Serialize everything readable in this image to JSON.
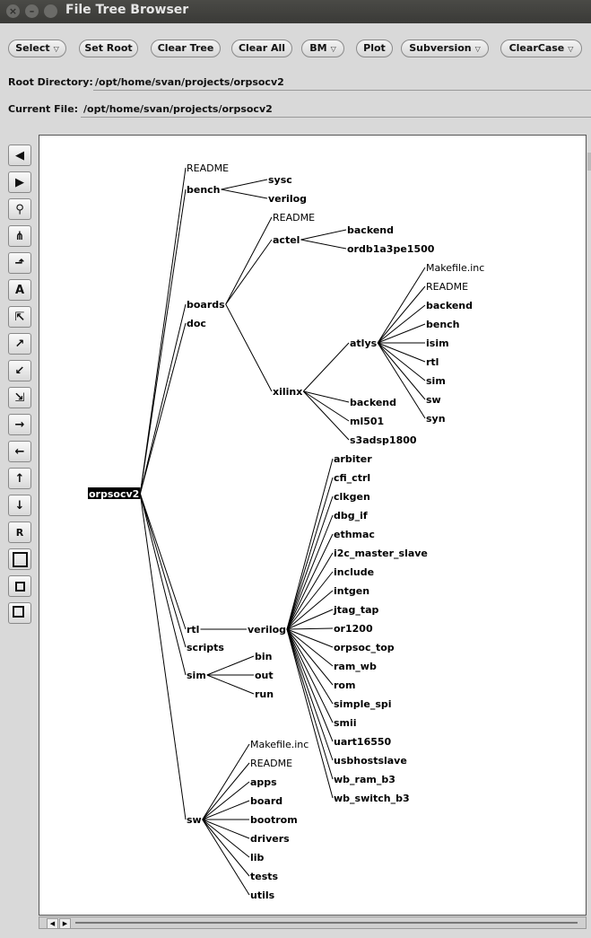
{
  "window": {
    "title": "File Tree Browser"
  },
  "toolbar": {
    "select": "Select",
    "set_root": "Set Root",
    "clear_tree": "Clear Tree",
    "clear_all": "Clear All",
    "bm": "BM",
    "plot": "Plot",
    "subversion": "Subversion",
    "clearcase": "ClearCase"
  },
  "paths": {
    "root_label": "Root Directory:",
    "root_value": "/opt/home/svan/projects/orpsocv2",
    "current_label": "Current File:",
    "current_value": "/opt/home/svan/projects/orpsocv2"
  },
  "sidebar": {
    "text_tool": "A",
    "refresh": "R"
  },
  "tree": {
    "root": "orpsocv2",
    "nodes": [
      {
        "id": "readme1",
        "label": "README",
        "parent": "root",
        "bold": false
      },
      {
        "id": "bench",
        "label": "bench",
        "parent": "root",
        "bold": true
      },
      {
        "id": "sysc",
        "label": "sysc",
        "parent": "bench",
        "bold": true
      },
      {
        "id": "verilog1",
        "label": "verilog",
        "parent": "bench",
        "bold": true
      },
      {
        "id": "boards",
        "label": "boards",
        "parent": "root",
        "bold": true
      },
      {
        "id": "readme2",
        "label": "README",
        "parent": "boards",
        "bold": false
      },
      {
        "id": "actel",
        "label": "actel",
        "parent": "boards",
        "bold": true
      },
      {
        "id": "backend1",
        "label": "backend",
        "parent": "actel",
        "bold": true
      },
      {
        "id": "ordb",
        "label": "ordb1a3pe1500",
        "parent": "actel",
        "bold": true
      },
      {
        "id": "xilinx",
        "label": "xilinx",
        "parent": "boards",
        "bold": true
      },
      {
        "id": "atlys",
        "label": "atlys",
        "parent": "xilinx",
        "bold": true
      },
      {
        "id": "mkinc1",
        "label": "Makefile.inc",
        "parent": "atlys",
        "bold": false
      },
      {
        "id": "readme3",
        "label": "README",
        "parent": "atlys",
        "bold": false
      },
      {
        "id": "backend2",
        "label": "backend",
        "parent": "atlys",
        "bold": true
      },
      {
        "id": "bench2",
        "label": "bench",
        "parent": "atlys",
        "bold": true
      },
      {
        "id": "isim",
        "label": "isim",
        "parent": "atlys",
        "bold": true
      },
      {
        "id": "rtl2",
        "label": "rtl",
        "parent": "atlys",
        "bold": true
      },
      {
        "id": "sim2",
        "label": "sim",
        "parent": "atlys",
        "bold": true
      },
      {
        "id": "sw2",
        "label": "sw",
        "parent": "atlys",
        "bold": true
      },
      {
        "id": "syn",
        "label": "syn",
        "parent": "atlys",
        "bold": true
      },
      {
        "id": "backend3",
        "label": "backend",
        "parent": "xilinx",
        "bold": true
      },
      {
        "id": "ml501",
        "label": "ml501",
        "parent": "xilinx",
        "bold": true
      },
      {
        "id": "s3adsp",
        "label": "s3adsp1800",
        "parent": "xilinx",
        "bold": true
      },
      {
        "id": "doc",
        "label": "doc",
        "parent": "root",
        "bold": true
      },
      {
        "id": "rtl",
        "label": "rtl",
        "parent": "root",
        "bold": true
      },
      {
        "id": "verilog2",
        "label": "verilog",
        "parent": "rtl",
        "bold": true
      },
      {
        "id": "arbiter",
        "label": "arbiter",
        "parent": "verilog2",
        "bold": true
      },
      {
        "id": "cfi",
        "label": "cfi_ctrl",
        "parent": "verilog2",
        "bold": true
      },
      {
        "id": "clkgen",
        "label": "clkgen",
        "parent": "verilog2",
        "bold": true
      },
      {
        "id": "dbg",
        "label": "dbg_if",
        "parent": "verilog2",
        "bold": true
      },
      {
        "id": "ethmac",
        "label": "ethmac",
        "parent": "verilog2",
        "bold": true
      },
      {
        "id": "i2c",
        "label": "i2c_master_slave",
        "parent": "verilog2",
        "bold": true
      },
      {
        "id": "include",
        "label": "include",
        "parent": "verilog2",
        "bold": true
      },
      {
        "id": "intgen",
        "label": "intgen",
        "parent": "verilog2",
        "bold": true
      },
      {
        "id": "jtag",
        "label": "jtag_tap",
        "parent": "verilog2",
        "bold": true
      },
      {
        "id": "or1200",
        "label": "or1200",
        "parent": "verilog2",
        "bold": true
      },
      {
        "id": "orpsoctop",
        "label": "orpsoc_top",
        "parent": "verilog2",
        "bold": true
      },
      {
        "id": "ramwb",
        "label": "ram_wb",
        "parent": "verilog2",
        "bold": true
      },
      {
        "id": "rom",
        "label": "rom",
        "parent": "verilog2",
        "bold": true
      },
      {
        "id": "spi",
        "label": "simple_spi",
        "parent": "verilog2",
        "bold": true
      },
      {
        "id": "smii",
        "label": "smii",
        "parent": "verilog2",
        "bold": true
      },
      {
        "id": "uart",
        "label": "uart16550",
        "parent": "verilog2",
        "bold": true
      },
      {
        "id": "usb",
        "label": "usbhostslave",
        "parent": "verilog2",
        "bold": true
      },
      {
        "id": "wbram",
        "label": "wb_ram_b3",
        "parent": "verilog2",
        "bold": true
      },
      {
        "id": "wbsw",
        "label": "wb_switch_b3",
        "parent": "verilog2",
        "bold": true
      },
      {
        "id": "scripts",
        "label": "scripts",
        "parent": "root",
        "bold": true
      },
      {
        "id": "sim",
        "label": "sim",
        "parent": "root",
        "bold": true
      },
      {
        "id": "bin",
        "label": "bin",
        "parent": "sim",
        "bold": true
      },
      {
        "id": "out",
        "label": "out",
        "parent": "sim",
        "bold": true
      },
      {
        "id": "run",
        "label": "run",
        "parent": "sim",
        "bold": true
      },
      {
        "id": "sw",
        "label": "sw",
        "parent": "root",
        "bold": true
      },
      {
        "id": "mkinc2",
        "label": "Makefile.inc",
        "parent": "sw",
        "bold": false
      },
      {
        "id": "readme4",
        "label": "README",
        "parent": "sw",
        "bold": false
      },
      {
        "id": "apps",
        "label": "apps",
        "parent": "sw",
        "bold": true
      },
      {
        "id": "board",
        "label": "board",
        "parent": "sw",
        "bold": true
      },
      {
        "id": "bootrom",
        "label": "bootrom",
        "parent": "sw",
        "bold": true
      },
      {
        "id": "drivers",
        "label": "drivers",
        "parent": "sw",
        "bold": true
      },
      {
        "id": "lib",
        "label": "lib",
        "parent": "sw",
        "bold": true
      },
      {
        "id": "tests",
        "label": "tests",
        "parent": "sw",
        "bold": true
      },
      {
        "id": "utils",
        "label": "utils",
        "parent": "sw",
        "bold": true
      }
    ]
  }
}
